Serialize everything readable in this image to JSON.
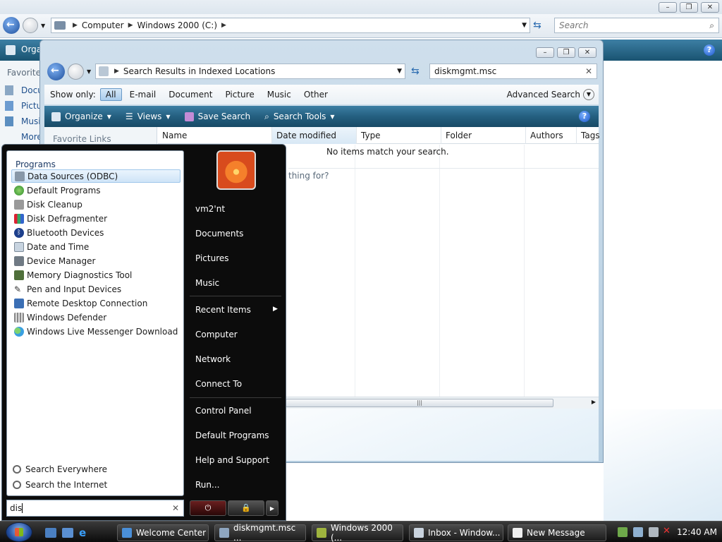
{
  "background_window": {
    "breadcrumb": [
      "Computer",
      "Windows 2000 (C:)"
    ],
    "search_placeholder": "Search",
    "cmd_partial": "Orga",
    "side_title_partial": "Favorite",
    "side_items_partial": [
      "Docu",
      "Pictu",
      "Musi",
      "More"
    ]
  },
  "search_window": {
    "address": "Search Results in Indexed Locations",
    "search_value": "diskmgmt.msc",
    "filter_label": "Show only:",
    "filters": [
      "All",
      "E-mail",
      "Document",
      "Picture",
      "Music",
      "Other"
    ],
    "advanced_search": "Advanced Search",
    "commands": {
      "organize": "Organize",
      "views": "Views",
      "save_search": "Save Search",
      "search_tools": "Search Tools"
    },
    "favorite_links": "Favorite Links",
    "columns": [
      "Name",
      "Date modified",
      "Type",
      "Folder",
      "Authors",
      "Tags"
    ],
    "empty_message": "No items match your search.",
    "partial_hint": "thing for?",
    "scroll_grip": "|||"
  },
  "start_menu": {
    "programs_label": "Programs",
    "programs": [
      "Data Sources (ODBC)",
      "Default Programs",
      "Disk Cleanup",
      "Disk Defragmenter",
      "Bluetooth Devices",
      "Date and Time",
      "Device Manager",
      "Memory Diagnostics Tool",
      "Pen and Input Devices",
      "Remote Desktop Connection",
      "Windows Defender",
      "Windows Live Messenger Download"
    ],
    "search_everywhere": "Search Everywhere",
    "search_internet": "Search the Internet",
    "search_value": "dis",
    "right_items": {
      "user": "vm2'nt",
      "documents": "Documents",
      "pictures": "Pictures",
      "music": "Music",
      "recent_items": "Recent Items",
      "computer": "Computer",
      "network": "Network",
      "connect_to": "Connect To",
      "control_panel": "Control Panel",
      "default_programs": "Default Programs",
      "help_support": "Help and Support",
      "run": "Run..."
    }
  },
  "taskbar": {
    "tasks": [
      "Welcome Center",
      "diskmgmt.msc ...",
      "Windows 2000 (...",
      "Inbox - Window...",
      "New Message"
    ],
    "clock": "12:40 AM"
  }
}
